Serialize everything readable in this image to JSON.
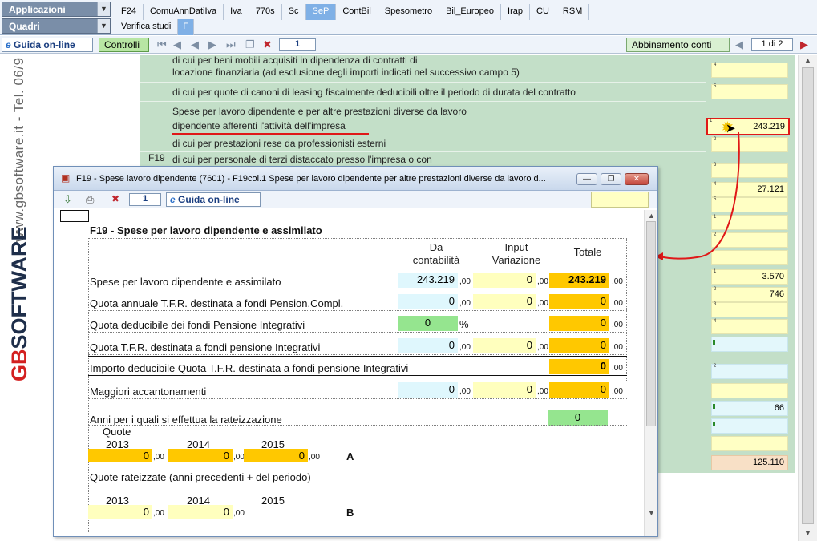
{
  "menu": {
    "applicazioni": "Applicazioni",
    "quadri": "Quadri",
    "tabs_row1": [
      "F24",
      "ComuAnnDatiIva",
      "Iva",
      "770s",
      "Sc",
      "SeP",
      "ContBil",
      "Spesometro",
      "Bil_Europeo",
      "Irap",
      "CU",
      "RSM"
    ],
    "active_tab": "SeP",
    "tabs_row2": [
      "Verifica studi",
      "F"
    ]
  },
  "toolbar": {
    "guida": "Guida on-line",
    "controlli": "Controlli",
    "page_num": "1",
    "abbinamento": "Abbinamento conti",
    "page_of": "1 di 2"
  },
  "brand": {
    "tel": "www.gbsoftware.it - Tel. 06/9",
    "logo_gb": "GB",
    "logo_soft": "SOFTWARE"
  },
  "form": {
    "row_a1": "di cui per beni mobili acquisiti in dipendenza di contratti di",
    "row_a2": "locazione finanziaria (ad esclusione degli importi indicati nel successivo campo 5)",
    "row_b": "di cui per quote di canoni di leasing fiscalmente deducibili oltre il periodo di durata del contratto",
    "row_c1": "Spese per lavoro dipendente e per altre prestazioni diverse da lavoro",
    "row_c2": "dipendente afferenti l'attività dell'impresa",
    "row_d": "di cui per prestazioni rese da professionisti esterni",
    "f19": "F19",
    "row_e": "di cui per personale di terzi distaccato presso l'impresa o con",
    "values": {
      "v_243219": "243.219",
      "v_27121": "27.121",
      "v_3570": "3.570",
      "v_746": "746",
      "v_66": "66",
      "v_125110": "125.110"
    },
    "field_nums": [
      "4",
      "5",
      "1",
      "2",
      "3",
      "4",
      "5",
      "1",
      "2",
      "1",
      "2",
      "3",
      "4",
      "2"
    ]
  },
  "dialog": {
    "title": "F19 - Spese lavoro dipendente (7601) - F19col.1 Spese per lavoro dipendente per altre prestazioni diverse da lavoro d...",
    "page_num": "1",
    "guida": "Guida on-line",
    "heading": "F19 - Spese per lavoro dipendente e assimilato",
    "col_da": "Da",
    "col_contabilita": "contabilità",
    "col_input": "Input",
    "col_variazione": "Variazione",
    "col_totale": "Totale",
    "decimals": ",00",
    "percent": "%",
    "rows": [
      {
        "label": "Spese per lavoro dipendente e assimilato",
        "da": "243.219",
        "input": "0",
        "totale": "243.219"
      },
      {
        "label": "Quota annuale T.F.R. destinata a fondi Pension.Compl.",
        "da": "0",
        "input": "0",
        "totale": "0"
      },
      {
        "label": "Quota deducibile dei fondi Pensione Integrativi",
        "perc": "0",
        "totale": "0"
      },
      {
        "label": "Quota T.F.R. destinata a fondi pensione Integrativi",
        "da": "0",
        "input": "0",
        "totale": "0"
      },
      {
        "label": "Importo deducibile Quota T.F.R. destinata a fondi pensione Integrativi",
        "totale": "0"
      },
      {
        "label": "Maggiori accantonamenti",
        "da": "0",
        "input": "0",
        "totale": "0"
      }
    ],
    "anni_label": "Anni per i quali si effettua la rateizzazione",
    "anni_value": "0",
    "quote_label": "Quote",
    "years": [
      "2013",
      "2014",
      "2015"
    ],
    "quote_values": [
      "0",
      "0",
      "0"
    ],
    "letter_a": "A",
    "rateizzate_label": "Quote rateizzate  (anni precedenti + del periodo)",
    "rate_values": [
      "0",
      "0"
    ],
    "letter_b": "B"
  }
}
